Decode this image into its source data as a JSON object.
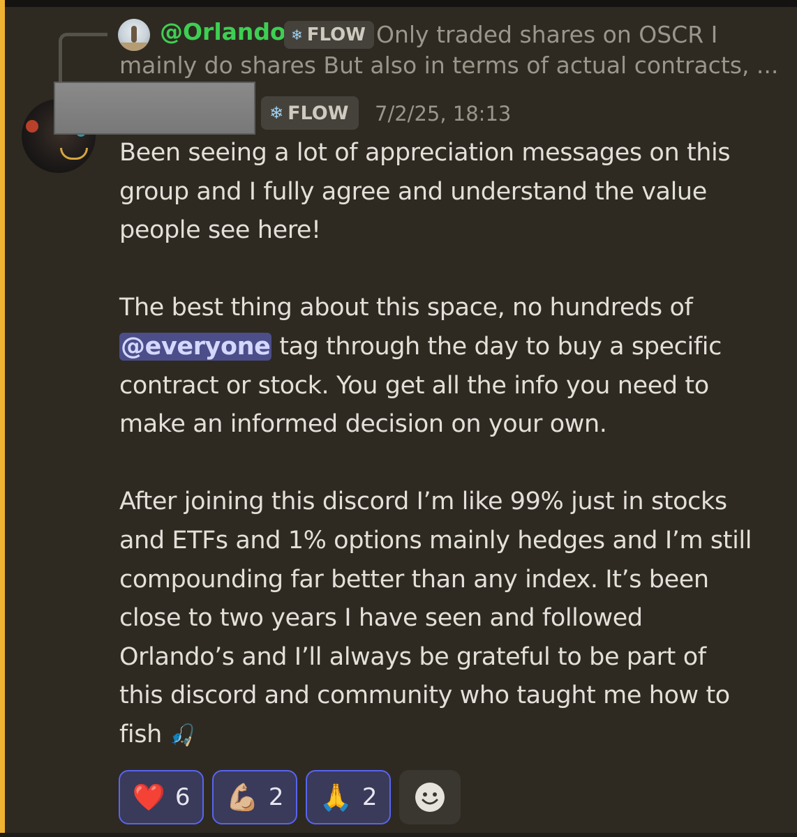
{
  "reply": {
    "author": "@Orlando",
    "tag": "FLOW",
    "text_line1": "Only traded shares on OSCR  I",
    "text_line2": "mainly do shares  But also in terms of actual contracts, ..."
  },
  "message": {
    "tag": "FLOW",
    "timestamp": "7/2/25, 18:13",
    "p1": [
      "Been seeing a lot of appreciation messages on this",
      "group and I fully agree and understand the value",
      "people see here!"
    ],
    "p2_line1": "The best thing about this space, no hundreds of",
    "mention": "@everyone",
    "p2_line2_rest": " tag through the day to buy a specific",
    "p2_rest": [
      "contract or stock. You get all the info you need to",
      "make an informed decision on your own."
    ],
    "p3": [
      "After joining this discord I’m like 99% just in stocks",
      "and ETFs and 1% options mainly hedges and I’m still",
      "compounding far better than any index. It’s been",
      "close to two years I have seen and followed",
      "Orlando’s and I’ll always be grateful to be part of",
      "this discord and community who taught me how to"
    ],
    "last_line": "fish ",
    "last_emoji": "🎣"
  },
  "reactions": [
    {
      "emoji": "❤️",
      "count": "6",
      "icon": "heart-icon"
    },
    {
      "emoji": "💪🏼",
      "count": "2",
      "icon": "flexed-biceps-icon"
    },
    {
      "emoji": "🙏",
      "count": "2",
      "icon": "folded-hands-icon"
    }
  ],
  "colors": {
    "background": "#2e2a22",
    "highlight_bar": "#f0b232",
    "reply_author": "#3ecf52",
    "mention_bg": "#4c4e8a",
    "reaction_border": "#5864f2"
  }
}
